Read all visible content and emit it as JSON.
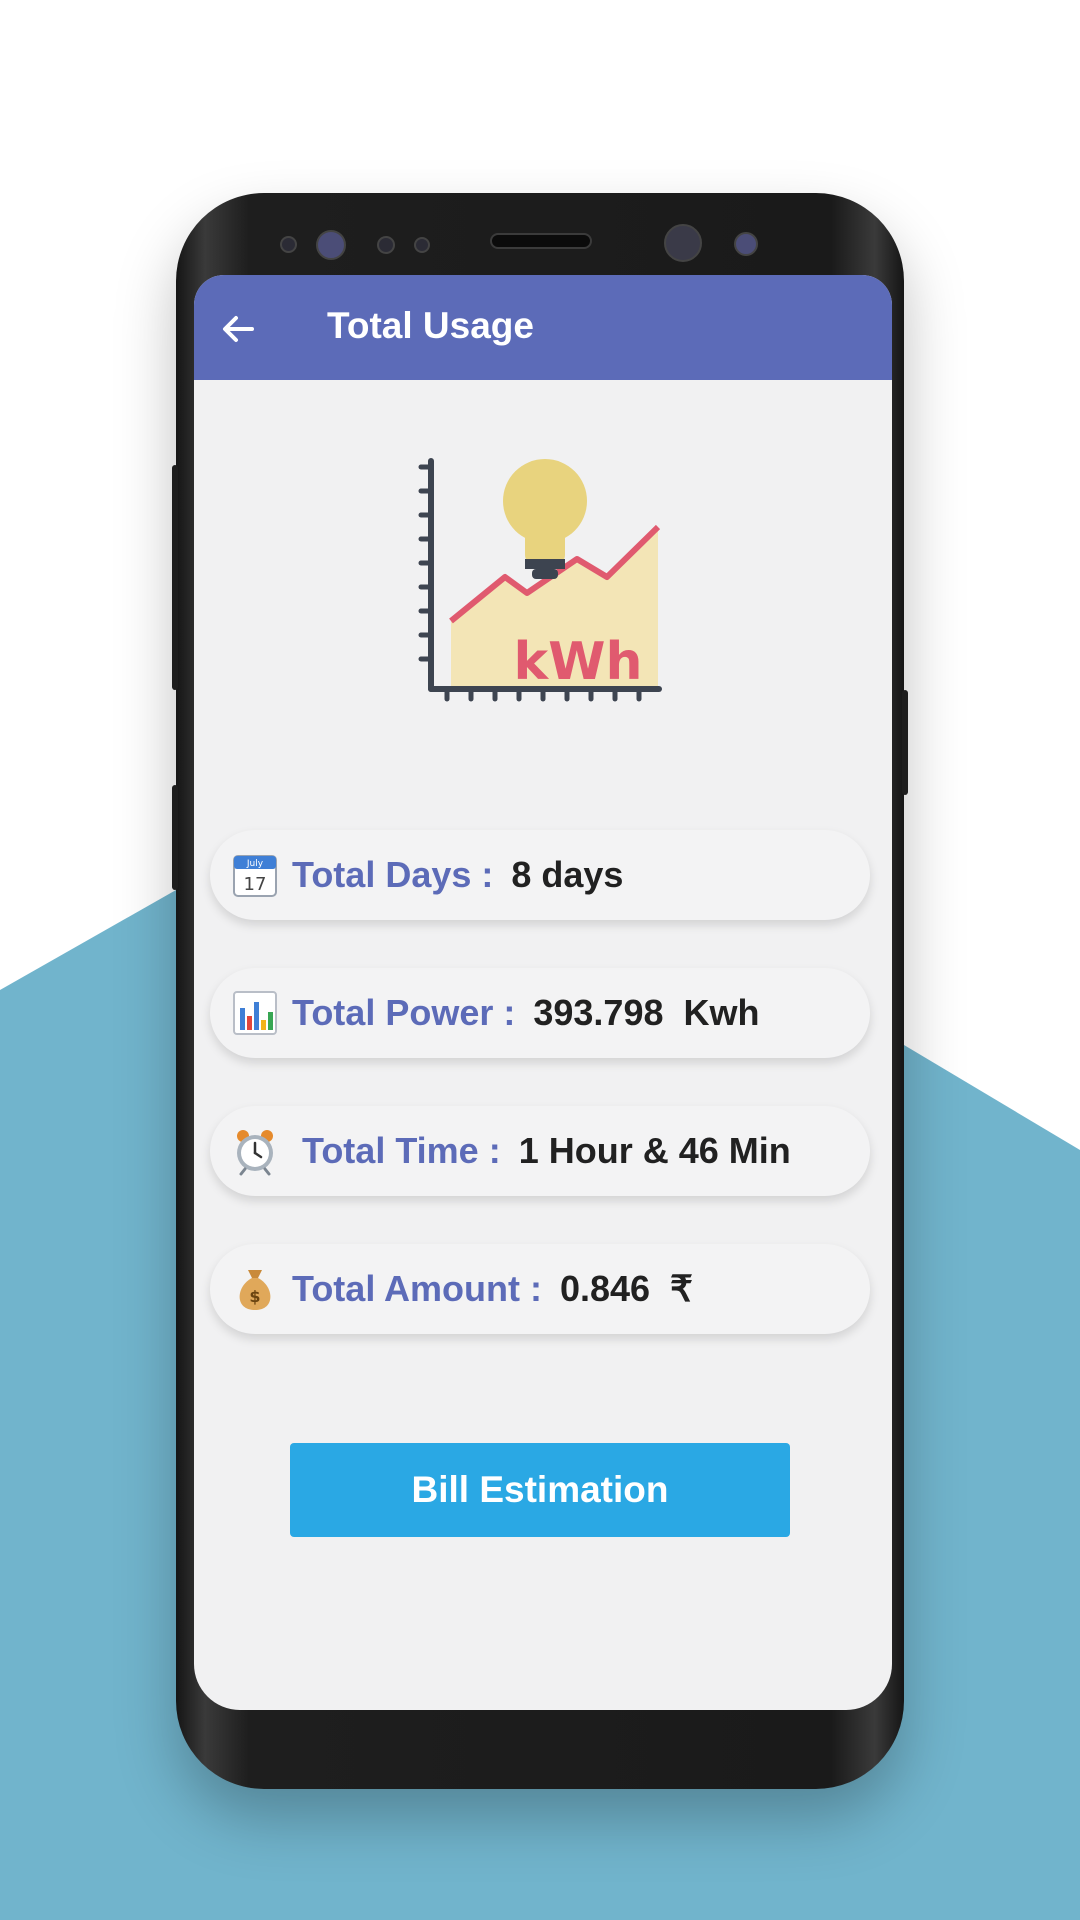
{
  "app_bar": {
    "back_icon": "arrow-left-icon",
    "title": "Total Usage"
  },
  "hero": {
    "icon": "kwh-chart-bulb-icon",
    "text": "kWh"
  },
  "stats": [
    {
      "icon": "calendar-icon",
      "calendar_month": "July",
      "calendar_day": "17",
      "label": "Total Days :",
      "value": "8 days"
    },
    {
      "icon": "bar-chart-icon",
      "label": "Total Power :",
      "value": "393.798  Kwh"
    },
    {
      "icon": "alarm-clock-icon",
      "label": "Total Time :",
      "value": "1 Hour & 46 Min"
    },
    {
      "icon": "money-bag-icon",
      "bag_symbol": "$",
      "label": "Total Amount :",
      "value": "0.846  ₹"
    }
  ],
  "bill_button": {
    "label": "Bill Estimation"
  },
  "colors": {
    "app_bar": "#5c6bb8",
    "label": "#5c6bb8",
    "button": "#2aa8e4",
    "background_shape": "#71b4cc"
  }
}
